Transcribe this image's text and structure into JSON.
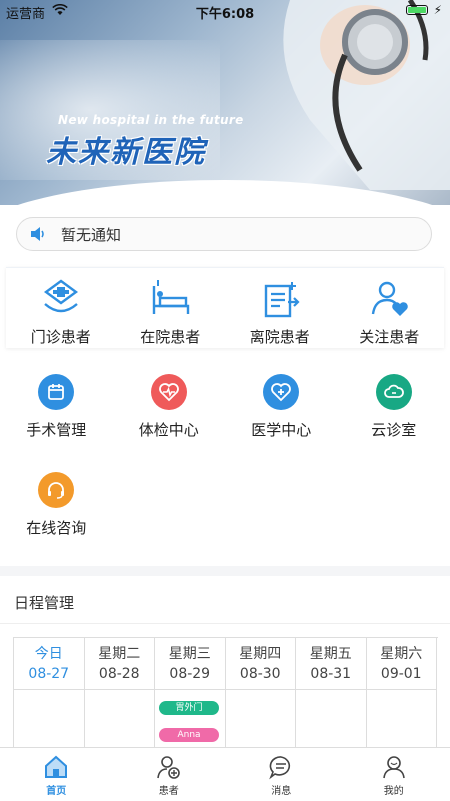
{
  "status_bar": {
    "carrier": "运营商",
    "time": "下午6:08"
  },
  "banner": {
    "title_en": "New hospital in the future",
    "title_cn": "未来新医院"
  },
  "notice": {
    "text": "暂无通知"
  },
  "patient_menu": [
    {
      "label": "门诊患者",
      "icon": "outpatient-icon"
    },
    {
      "label": "在院患者",
      "icon": "inpatient-bed-icon"
    },
    {
      "label": "离院患者",
      "icon": "discharged-icon"
    },
    {
      "label": "关注患者",
      "icon": "followed-patient-icon"
    }
  ],
  "service_menu": [
    {
      "label": "手术管理",
      "icon": "surgery-calendar-icon",
      "color": "#2f8fe0"
    },
    {
      "label": "体检中心",
      "icon": "heartbeat-icon",
      "color": "#ef5a5a"
    },
    {
      "label": "医学中心",
      "icon": "medical-heart-icon",
      "color": "#2f8fe0"
    },
    {
      "label": "云诊室",
      "icon": "cloud-clinic-icon",
      "color": "#18a884"
    },
    {
      "label": "在线咨询",
      "icon": "headset-icon",
      "color": "#f39a2b"
    }
  ],
  "schedule": {
    "title": "日程管理",
    "days": [
      {
        "weekday": "今日",
        "date": "08-27",
        "today": true
      },
      {
        "weekday": "星期二",
        "date": "08-28"
      },
      {
        "weekday": "星期三",
        "date": "08-29"
      },
      {
        "weekday": "星期四",
        "date": "08-30"
      },
      {
        "weekday": "星期五",
        "date": "08-31"
      },
      {
        "weekday": "星期六",
        "date": "09-01"
      }
    ],
    "events": [
      {
        "text": "胃外门",
        "color": "#1fb88a"
      },
      {
        "text": "Anna",
        "color": "#f06aa8"
      }
    ]
  },
  "tabbar": [
    {
      "label": "首页",
      "icon": "home-icon",
      "active": true
    },
    {
      "label": "患者",
      "icon": "patient-icon"
    },
    {
      "label": "消息",
      "icon": "message-icon"
    },
    {
      "label": "我的",
      "icon": "profile-icon"
    }
  ],
  "colors": {
    "accent": "#2f8fe0"
  }
}
